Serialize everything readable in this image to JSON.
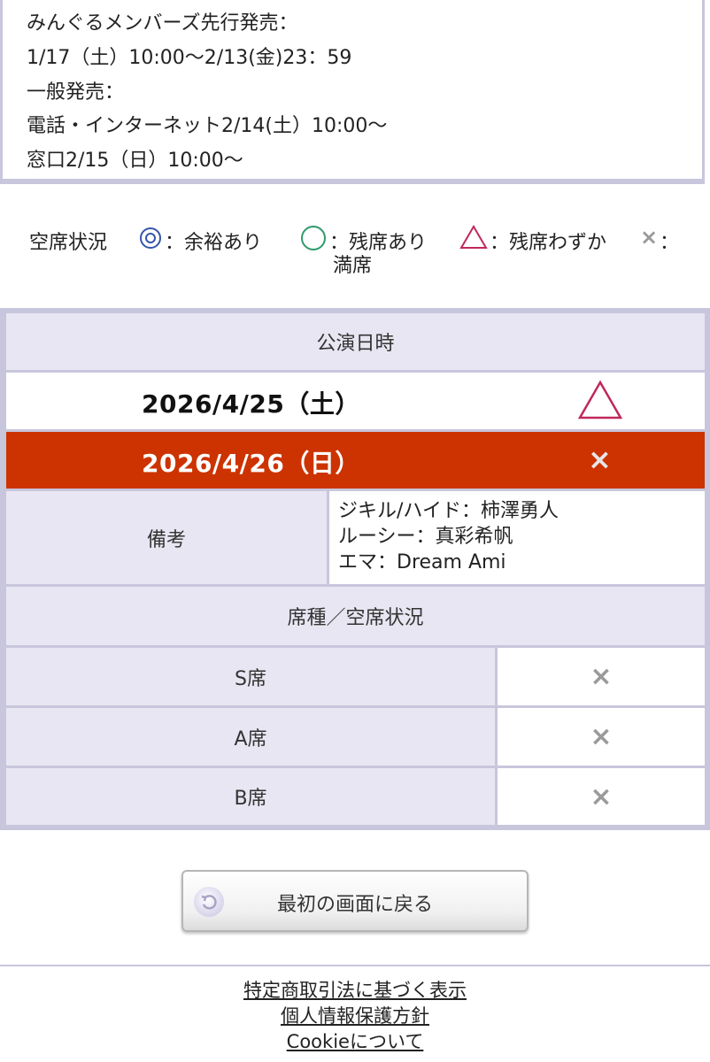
{
  "sale_info": {
    "lines": [
      "みんぐるメンバーズ先行発売：",
      "1/17（土）10:00〜2/13(金)23：59",
      "一般発売：",
      "電話・インターネット2/14(土）10:00〜",
      "窓口2/15（日）10:00〜"
    ]
  },
  "legend": {
    "title": "空席状況",
    "items": [
      {
        "icon": "double-circle-icon",
        "label": "：余裕あり",
        "color": "#3355aa"
      },
      {
        "icon": "circle-icon",
        "label": "：残席あり",
        "color": "#2f9a6c"
      },
      {
        "icon": "triangle-icon",
        "label": "：残席わずか",
        "color": "#c0285a"
      },
      {
        "icon": "cross-icon",
        "label": "：",
        "color": "#9a9a9a"
      }
    ],
    "overflow": "満席"
  },
  "schedule": {
    "header": "公演日時",
    "dates": [
      {
        "date": "2026/4/25（土）",
        "status_icon": "triangle-icon",
        "selected": false
      },
      {
        "date": "2026/4/26（日）",
        "status": "×",
        "selected": true
      }
    ],
    "notes_label": "備考",
    "notes": [
      "ジキル/ハイド：柿澤勇人",
      "ルーシー：真彩希帆",
      "エマ：Dream Ami"
    ],
    "seat_header": "席種／空席状況",
    "seats": [
      {
        "name": "S席",
        "status": "×"
      },
      {
        "name": "A席",
        "status": "×"
      },
      {
        "name": "B席",
        "status": "×"
      }
    ]
  },
  "back_button": {
    "label": "最初の画面に戻る"
  },
  "footer": {
    "links": [
      "特定商取引法に基づく表示",
      "個人情報保護方針",
      "Cookieについて"
    ]
  },
  "colors": {
    "selected_row": "#cc3300",
    "border": "#c8c6dc",
    "header_bg": "#e8e6f2"
  }
}
